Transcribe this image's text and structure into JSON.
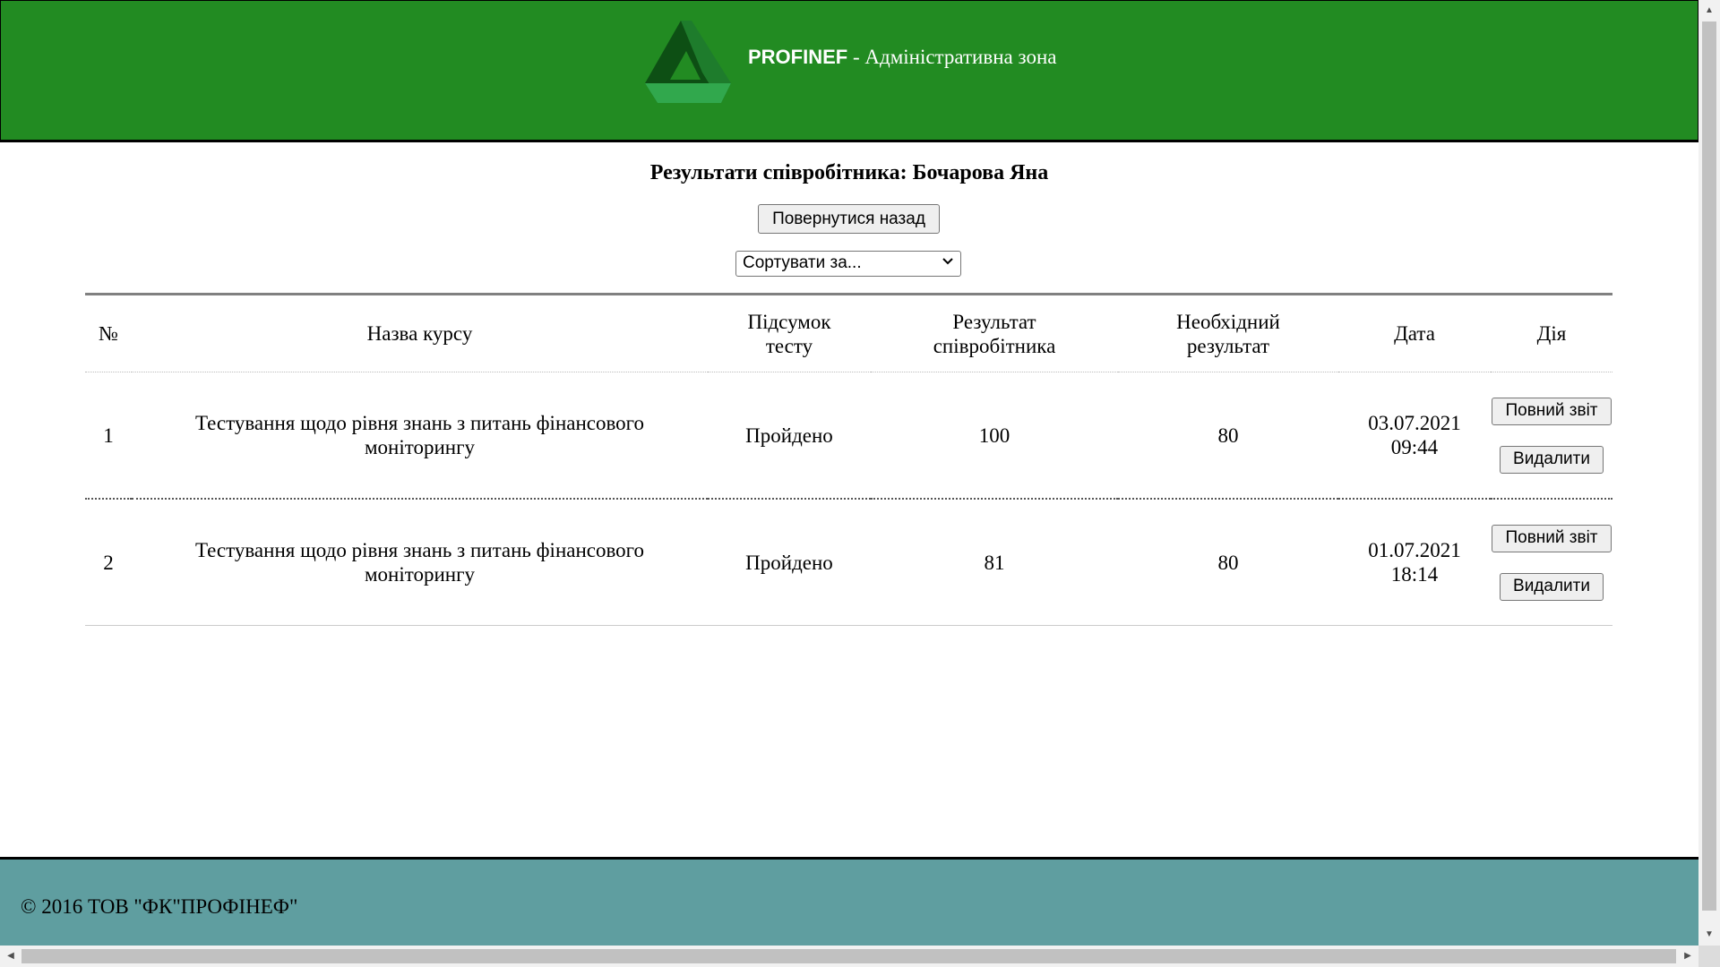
{
  "header": {
    "brand_name": "PROFINEF",
    "brand_suffix": " - Адміністративна зона",
    "logo_icon": "triangle-logo-icon",
    "logo_colors": [
      "#0b4d12",
      "#1d7a2a",
      "#2ea84a"
    ]
  },
  "main": {
    "title": "Результати співробітника: Бочарова Яна",
    "back_button": "Повернутися назад",
    "sort_select": {
      "selected": "Сортувати за..."
    },
    "table": {
      "columns": [
        "№",
        "Назва курсу",
        "Підсумок тесту",
        "Результат співробітника",
        "Необхідний результат",
        "Дата",
        "Дія"
      ],
      "rows": [
        {
          "num": "1",
          "course": "Тестування щодо рівня знань з питань фінансового моніторингу",
          "summary": "Пройдено",
          "employee_result": "100",
          "required_result": "80",
          "date": "03.07.2021",
          "time": "09:44",
          "full_report": "Повний звіт",
          "delete": "Видалити"
        },
        {
          "num": "2",
          "course": "Тестування щодо рівня знань з питань фінансового моніторингу",
          "summary": "Пройдено",
          "employee_result": "81",
          "required_result": "80",
          "date": "01.07.2021",
          "time": "18:14",
          "full_report": "Повний звіт",
          "delete": "Видалити"
        }
      ]
    }
  },
  "footer": {
    "copyright": "© 2016 ТОВ \"ФК\"ПРОФІНЕФ\""
  },
  "colors": {
    "header_bg": "#228b22",
    "footer_bg": "#5f9ea0"
  }
}
